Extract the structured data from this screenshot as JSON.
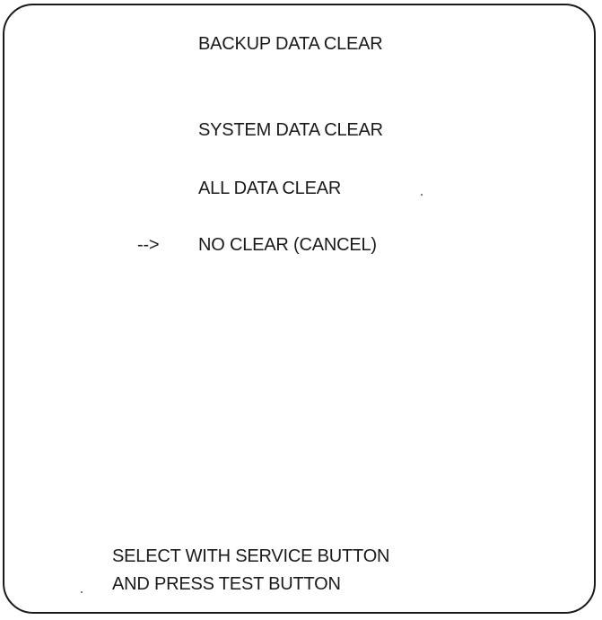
{
  "screen": {
    "title": "BACKUP DATA CLEAR",
    "options": [
      {
        "label": "SYSTEM DATA CLEAR",
        "selected": false
      },
      {
        "label": "ALL DATA CLEAR",
        "selected": false
      },
      {
        "label": "NO CLEAR (CANCEL)",
        "selected": true
      }
    ],
    "cursor": "-->",
    "instructions": [
      "SELECT WITH SERVICE BUTTON",
      "AND PRESS TEST BUTTON"
    ]
  }
}
